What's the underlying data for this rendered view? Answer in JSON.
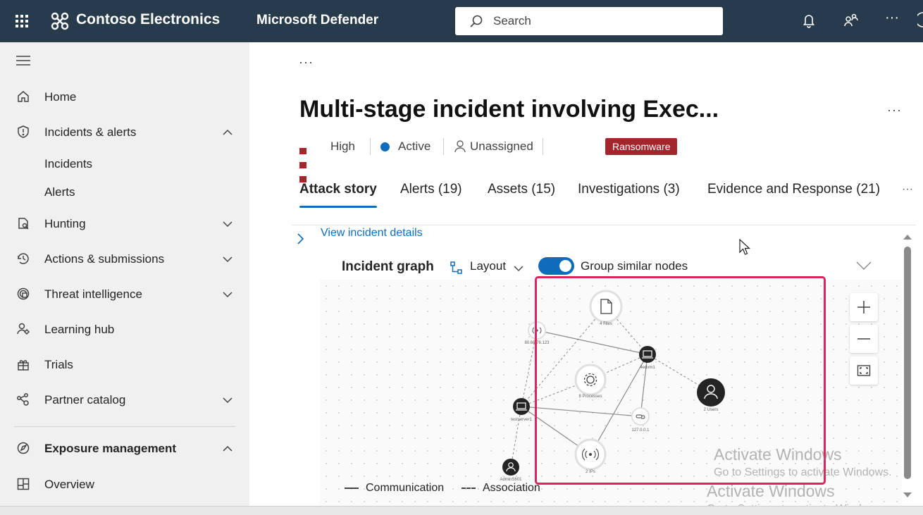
{
  "topbar": {
    "org_name": "Contoso Electronics",
    "product_name": "Microsoft Defender",
    "search_placeholder": "Search",
    "more_label": "···"
  },
  "nav": {
    "items": [
      {
        "label": "Home",
        "icon": "home-icon"
      },
      {
        "label": "Incidents & alerts",
        "icon": "shield-icon",
        "expanded": true
      },
      {
        "label": "Incidents"
      },
      {
        "label": "Alerts"
      },
      {
        "label": "Hunting",
        "icon": "hunting-icon",
        "expanded": false
      },
      {
        "label": "Actions & submissions",
        "icon": "actions-icon",
        "expanded": false
      },
      {
        "label": "Threat intelligence",
        "icon": "threat-intel-icon",
        "expanded": false
      },
      {
        "label": "Learning hub",
        "icon": "learning-hub-icon"
      },
      {
        "label": "Trials",
        "icon": "trials-icon"
      },
      {
        "label": "Partner catalog",
        "icon": "partner-catalog-icon",
        "expanded": false
      },
      {
        "label": "Exposure management",
        "icon": "exposure-icon",
        "expanded": true
      },
      {
        "label": "Overview",
        "icon": "overview-icon"
      }
    ]
  },
  "incident": {
    "breadcrumb_more": "···",
    "title": "Multi-stage incident involving Exec...",
    "title_more": "···",
    "severity": "High",
    "status": "Active",
    "assigned": "Unassigned",
    "tag": "Ransomware",
    "colors": {
      "severity": "#a4262c",
      "status": "#0f6cbd",
      "tag": "#a4262c"
    }
  },
  "tabs": [
    {
      "label": "Attack story",
      "active": true
    },
    {
      "label": "Alerts (19)"
    },
    {
      "label": "Assets (15)"
    },
    {
      "label": "Investigations (3)"
    },
    {
      "label": "Evidence and Response (21)"
    }
  ],
  "tabs_more": "···",
  "details_link": "View incident details",
  "graph": {
    "title": "Incident graph",
    "layout_label": "Layout",
    "toggle_label": "Group similar nodes",
    "toggle_on": true,
    "nodes": [
      {
        "label": "4 Files",
        "icon": "file-icon"
      },
      {
        "label": "80.66.76.123",
        "icon": "ip-icon"
      },
      {
        "label": "4edvm1",
        "icon": "device-icon"
      },
      {
        "label": "8 Processes",
        "icon": "process-icon"
      },
      {
        "label": "2 Users",
        "icon": "user-icon"
      },
      {
        "label": "testserver1",
        "icon": "device-icon"
      },
      {
        "label": "127.0.0.1",
        "icon": "url-icon"
      },
      {
        "label": "2 IPs",
        "icon": "ip-icon"
      },
      {
        "label": "AdminS601",
        "icon": "user-icon"
      }
    ],
    "legend": {
      "communication": "Communication",
      "association": "Association"
    }
  },
  "watermark": {
    "title": "Activate Windows",
    "subtitle": "Go to Settings to activate Windows."
  }
}
